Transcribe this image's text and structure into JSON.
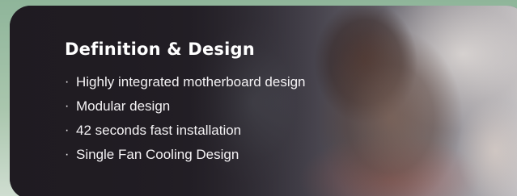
{
  "section": {
    "title": "Definition & Design",
    "features": [
      "Highly integrated motherboard design",
      "Modular design",
      "42 seconds fast installation",
      "Single Fan Cooling Design"
    ],
    "bullet_glyph": "·"
  },
  "colors": {
    "card_overlay": "#1e1a20",
    "text": "#ffffff",
    "page_background": "#a9c6ad"
  }
}
